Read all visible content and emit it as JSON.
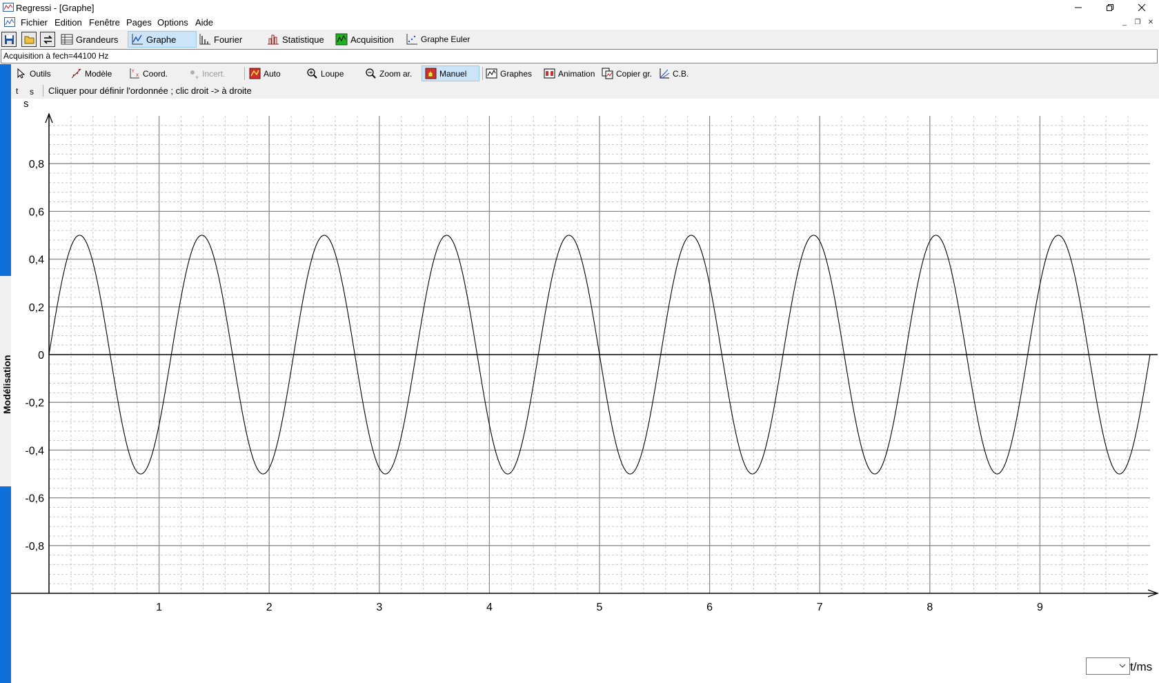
{
  "window": {
    "title": "Regressi - [Graphe]"
  },
  "menu": {
    "items": [
      "Fichier",
      "Edition",
      "Fenêtre",
      "Pages",
      "Options",
      "Aide"
    ]
  },
  "toolbar_main": {
    "grandeurs": "Grandeurs",
    "graphe": "Graphe",
    "fourier": "Fourier",
    "statistique": "Statistique",
    "acquisition": "Acquisition",
    "graphe_euler": "Graphe Euler"
  },
  "status": {
    "acquisition": "Acquisition à fech=44100 Hz"
  },
  "toolbar_graph": {
    "outils": "Outils",
    "modele": "Modèle",
    "coord": "Coord.",
    "incert": "Incert.",
    "auto": "Auto",
    "loupe": "Loupe",
    "zoom_ar": "Zoom ar.",
    "manuel": "Manuel",
    "graphes": "Graphes",
    "animation": "Animation",
    "copier_gr": "Copier gr.",
    "cb": "C.B."
  },
  "hint": {
    "t": "t",
    "s": "s",
    "text": "Cliquer pour définir l'ordonnée ; clic droit -> à droite"
  },
  "sidebar": {
    "label": "Modélisation"
  },
  "chart_data": {
    "type": "line",
    "ylabel": "s",
    "xlabel": "t/ms",
    "xlim": [
      0,
      10
    ],
    "ylim": [
      -1,
      1
    ],
    "y_ticks": [
      "0,8",
      "0,6",
      "0,4",
      "0,2",
      "0",
      "-0,2",
      "-0,4",
      "-0,6",
      "-0,8"
    ],
    "x_ticks": [
      "1",
      "2",
      "3",
      "4",
      "5",
      "6",
      "7",
      "8",
      "9"
    ],
    "grid": true,
    "series": [
      {
        "function": "sine",
        "amplitude": 0.5,
        "frequency_khz": 0.9,
        "x_start": 0,
        "x_end": 10
      }
    ]
  }
}
